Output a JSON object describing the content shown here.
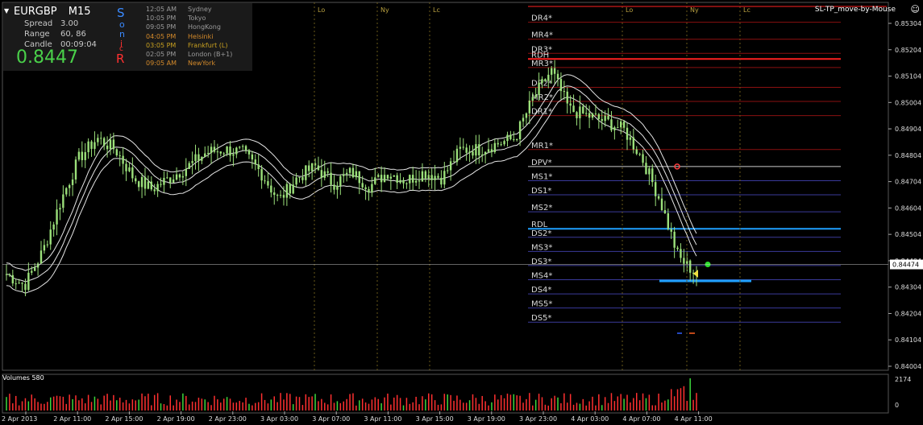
{
  "header": {
    "symbol_label": "EURGBP",
    "timeframe_label": "M15",
    "spread_label": "Spread",
    "spread_value": "3.00",
    "range_label": "Range",
    "range_value": "60, 86",
    "candle_label": "Candle",
    "candle_value": "00:09:04",
    "bid_price": "0.8447",
    "sonic_letters": [
      "S",
      "o",
      "n",
      "i",
      "c",
      "R"
    ]
  },
  "sessions": [
    {
      "time": "12:05 AM",
      "name": "Sydney",
      "color": "#9a9a9a"
    },
    {
      "time": "10:05 PM",
      "name": "Tokyo",
      "color": "#9a9a9a"
    },
    {
      "time": "09:05 PM",
      "name": "HongKong",
      "color": "#9a9a9a"
    },
    {
      "time": "04:05 PM",
      "name": "Helsinki",
      "color": "#d48a2a"
    },
    {
      "time": "03:05 PM",
      "name": "Frankfurt  (L)",
      "color": "#c8a020"
    },
    {
      "time": "02:05 PM",
      "name": "London  (B+1)",
      "color": "#9a9a9a"
    },
    {
      "time": "09:05 AM",
      "name": "NewYork",
      "color": "#d48a2a"
    }
  ],
  "corner_label": "SL-TP_move-by-Mouse",
  "session_marks": [
    "Lo",
    "Ny",
    "Lc",
    "Lo",
    "Ny",
    "Lc"
  ],
  "volume_label": "Volumes 580",
  "volume_axis": [
    "2174",
    "0"
  ],
  "colors": {
    "background": "#000000",
    "candle": "#9be07a",
    "grid": "#3a3a3a",
    "resistance": "#ff2020",
    "support": "#3a6aff",
    "pivot": "#ffffff",
    "volume": "#ff3030",
    "volume_up": "#3cd83c",
    "bid_line": "#c8c8c8",
    "highlight_blue": "#1fa0ff"
  },
  "chart_data": {
    "type": "candlestick",
    "symbol": "EURGBP",
    "timeframe": "M15",
    "ylim": [
      0.841,
      0.854
    ],
    "y_ticks": [
      "0.85304",
      "0.85204",
      "0.85104",
      "0.85004",
      "0.84904",
      "0.84804",
      "0.84704",
      "0.84604",
      "0.84504",
      "0.84404",
      "0.84304",
      "0.84204",
      "0.84104",
      "0.84004"
    ],
    "x_tick_labels": [
      "2 Apr 2013",
      "2 Apr 11:00",
      "2 Apr 15:00",
      "2 Apr 19:00",
      "2 Apr 23:00",
      "3 Apr 03:00",
      "3 Apr 07:00",
      "3 Apr 11:00",
      "3 Apr 15:00",
      "3 Apr 19:00",
      "3 Apr 23:00",
      "4 Apr 03:00",
      "4 Apr 07:00",
      "4 Apr 11:00"
    ],
    "current_price": "0.84474",
    "close_path": [
      0.8444,
      0.844,
      0.8452,
      0.847,
      0.8485,
      0.8492,
      0.8488,
      0.8478,
      0.8474,
      0.8478,
      0.8482,
      0.8487,
      0.8488,
      0.8487,
      0.848,
      0.847,
      0.8478,
      0.8482,
      0.8476,
      0.848,
      0.8475,
      0.848,
      0.8477,
      0.848,
      0.8478,
      0.8488,
      0.8488,
      0.849,
      0.8492,
      0.8506,
      0.8516,
      0.8502,
      0.85,
      0.8498,
      0.8495,
      0.8485,
      0.847,
      0.845,
      0.8444
    ],
    "pivot_levels": [
      {
        "name": "DR4*",
        "value": 0.8533,
        "kind": "r",
        "bright": false
      },
      {
        "name": "MR4*",
        "value": 0.8527,
        "kind": "r",
        "bright": false
      },
      {
        "name": "DR3*",
        "value": 0.8522,
        "kind": "r",
        "bright": false
      },
      {
        "name": "RDH",
        "value": 0.852,
        "kind": "r",
        "bright": true
      },
      {
        "name": "MR3*",
        "value": 0.8517,
        "kind": "r",
        "bright": false
      },
      {
        "name": "DR2*",
        "value": 0.851,
        "kind": "r",
        "bright": false
      },
      {
        "name": "MR2*",
        "value": 0.8505,
        "kind": "r",
        "bright": false
      },
      {
        "name": "DR1*",
        "value": 0.85,
        "kind": "r",
        "bright": false
      },
      {
        "name": "MR1*",
        "value": 0.8488,
        "kind": "r",
        "bright": false
      },
      {
        "name": "DPV*",
        "value": 0.8482,
        "kind": "p",
        "bright": false
      },
      {
        "name": "MS1*",
        "value": 0.8477,
        "kind": "s",
        "bright": false
      },
      {
        "name": "DS1*",
        "value": 0.8472,
        "kind": "s",
        "bright": false
      },
      {
        "name": "MS2*",
        "value": 0.8466,
        "kind": "s",
        "bright": false
      },
      {
        "name": "RDL",
        "value": 0.846,
        "kind": "s",
        "bright": true
      },
      {
        "name": "DS2*",
        "value": 0.8457,
        "kind": "s",
        "bright": false
      },
      {
        "name": "MS3*",
        "value": 0.8452,
        "kind": "s",
        "bright": false
      },
      {
        "name": "DS3*",
        "value": 0.8447,
        "kind": "s",
        "bright": false
      },
      {
        "name": "MS4*",
        "value": 0.8442,
        "kind": "s",
        "bright": false
      },
      {
        "name": "DS4*",
        "value": 0.8437,
        "kind": "s",
        "bright": false
      },
      {
        "name": "MS5*",
        "value": 0.8432,
        "kind": "s",
        "bright": false
      },
      {
        "name": "DS5*",
        "value": 0.8427,
        "kind": "s",
        "bright": false
      }
    ]
  }
}
